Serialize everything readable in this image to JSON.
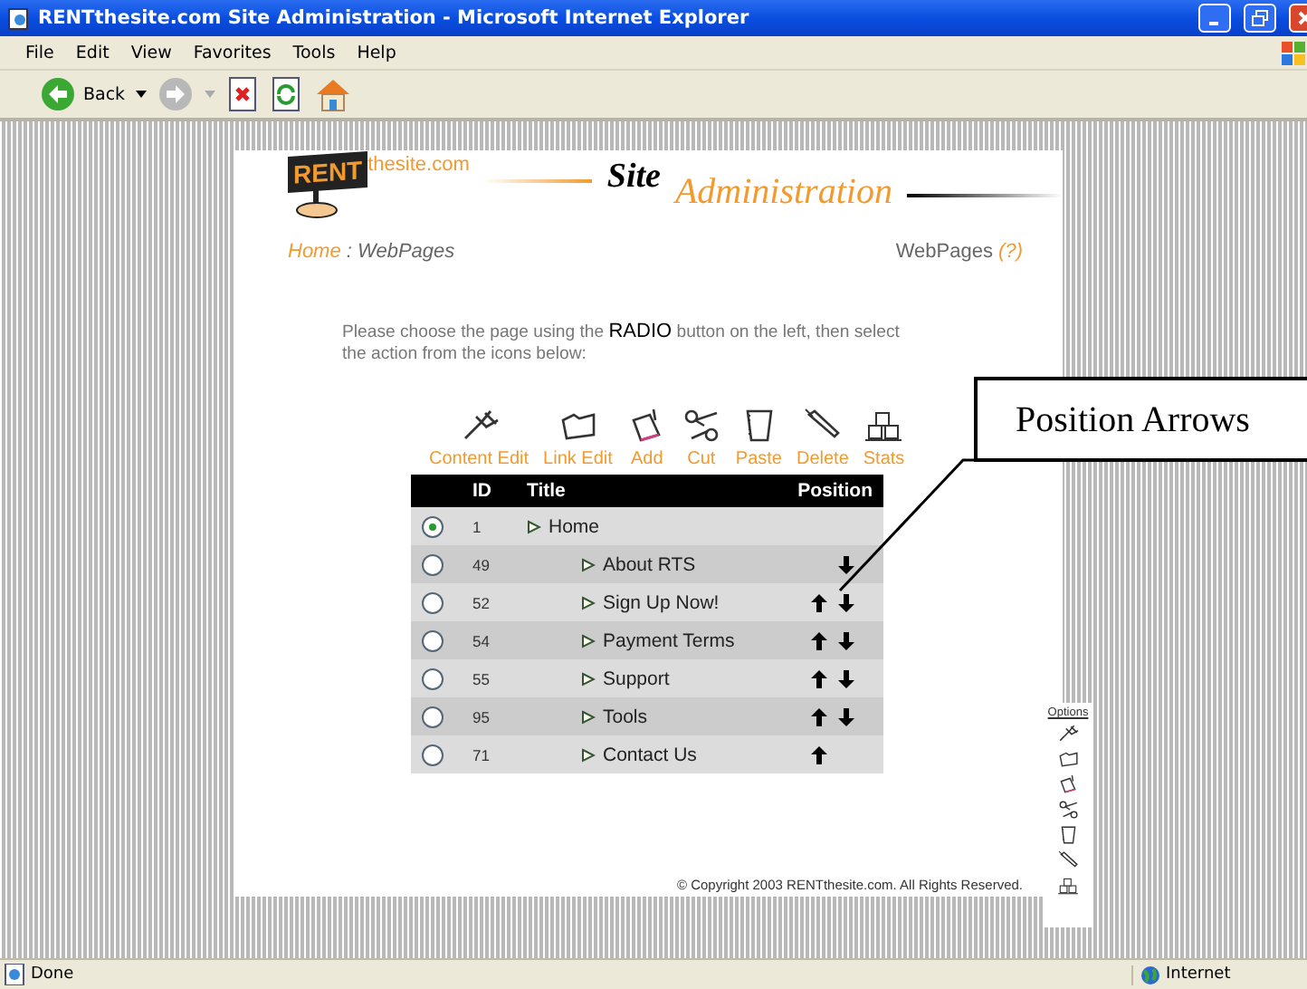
{
  "window": {
    "title": "RENTthesite.com Site Administration - Microsoft Internet Explorer"
  },
  "menu": [
    "File",
    "Edit",
    "View",
    "Favorites",
    "Tools",
    "Help"
  ],
  "toolbar": {
    "back": "Back"
  },
  "header": {
    "logo_sign": "RENT",
    "logo_domain": "thesite.com",
    "title_1": "Site",
    "title_2": "Administration"
  },
  "breadcrumb": {
    "home": "Home",
    "current": ": WebPages"
  },
  "help": {
    "label": "WebPages",
    "link": "(?)"
  },
  "instructions": "Please choose the page using the **RADIO** button on the left, then select the action from the icons below:",
  "actions": [
    {
      "label": "Content Edit"
    },
    {
      "label": "Link Edit"
    },
    {
      "label": "Add"
    },
    {
      "label": "Cut"
    },
    {
      "label": "Paste"
    },
    {
      "label": "Delete"
    },
    {
      "label": "Stats"
    }
  ],
  "table": {
    "columns": [
      "ID",
      "Title",
      "Position"
    ],
    "rows": [
      {
        "id": "1",
        "title": "Home",
        "selected": true,
        "move_up": false,
        "move_down": false,
        "children": [
          {
            "id": "49",
            "title": "About RTS",
            "selected": false,
            "move_up": false,
            "move_down": true
          },
          {
            "id": "52",
            "title": "Sign Up Now!",
            "selected": false,
            "move_up": true,
            "move_down": true
          },
          {
            "id": "54",
            "title": "Payment Terms",
            "selected": false,
            "move_up": true,
            "move_down": true
          },
          {
            "id": "55",
            "title": "Support",
            "selected": false,
            "move_up": true,
            "move_down": true
          },
          {
            "id": "95",
            "title": "Tools",
            "selected": false,
            "move_up": true,
            "move_down": true
          },
          {
            "id": "71",
            "title": "Contact Us",
            "selected": false,
            "move_up": true,
            "move_down": false
          }
        ]
      }
    ]
  },
  "callout": "Position Arrows",
  "options": {
    "title": "Options"
  },
  "footer": "© Copyright 2003 RENTthesite.com. All Rights Reserved.",
  "status": {
    "left": "Done",
    "zone": "Internet"
  }
}
